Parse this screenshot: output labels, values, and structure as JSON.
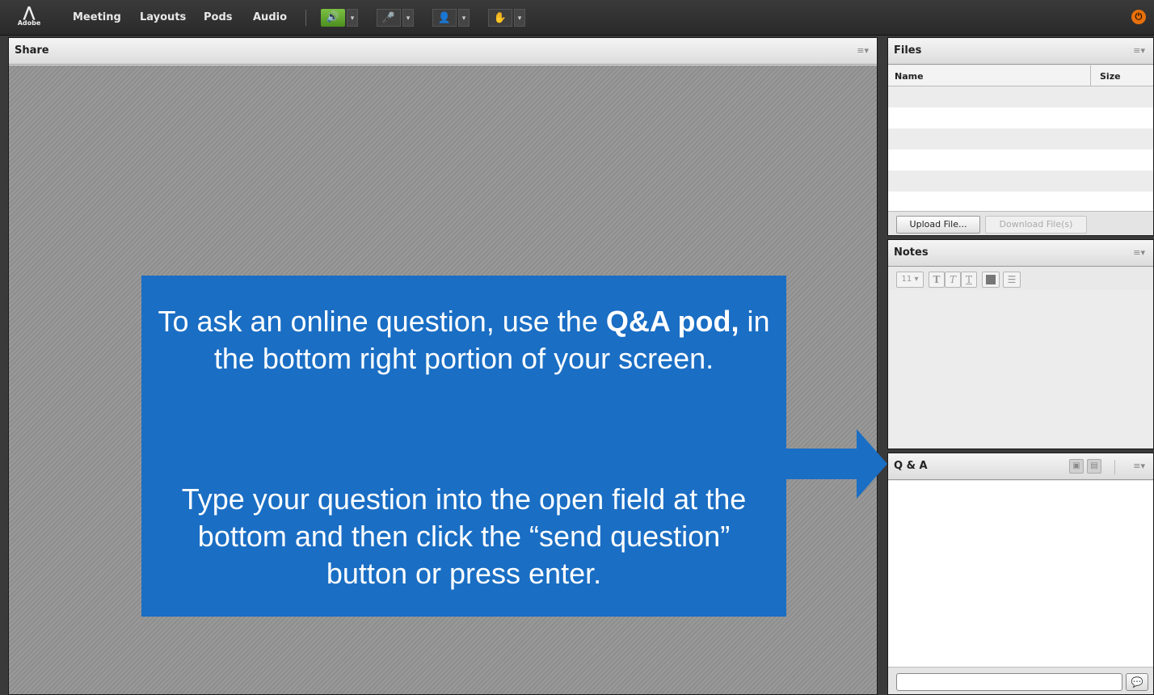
{
  "menubar": {
    "logo_text": "Adobe",
    "items": [
      "Meeting",
      "Layouts",
      "Pods",
      "Audio"
    ],
    "tools": [
      {
        "icon": "speaker-icon",
        "glyph": "🔊",
        "state": "on"
      },
      {
        "icon": "microphone-icon",
        "glyph": "🎤",
        "state": "off"
      },
      {
        "icon": "webcam-icon",
        "glyph": "👤",
        "state": "off"
      },
      {
        "icon": "raise-hand-icon",
        "glyph": "✋",
        "state": "off"
      }
    ],
    "dropdown_glyph": "▾",
    "power_glyph": "⏻",
    "colors": {
      "accent_green": "#6ab535",
      "power_orange": "#e8700a"
    }
  },
  "share": {
    "title": "Share",
    "menu_glyph": "≡▾",
    "callout": {
      "line1_pre": "To ask an online question, use the ",
      "line1_bold": "Q&A pod,",
      "line1_post": " in the bottom right portion of your screen.",
      "paragraph2": "Type your question into the open field at the bottom and then click the “send question” button or press enter.",
      "color": "#1a6ec4"
    }
  },
  "files": {
    "title": "Files",
    "menu_glyph": "≡▾",
    "columns": {
      "name": "Name",
      "size": "Size"
    },
    "upload_label": "Upload File...",
    "download_label": "Download File(s)"
  },
  "notes": {
    "title": "Notes",
    "menu_glyph": "≡▾",
    "font_size": "11",
    "toolbar": [
      "bold-icon",
      "italic-icon",
      "underline-icon",
      "color-icon",
      "list-icon"
    ]
  },
  "qa": {
    "title": "Q & A",
    "menu_glyph": "≡▾",
    "input_value": "",
    "send_glyph": "💬"
  }
}
